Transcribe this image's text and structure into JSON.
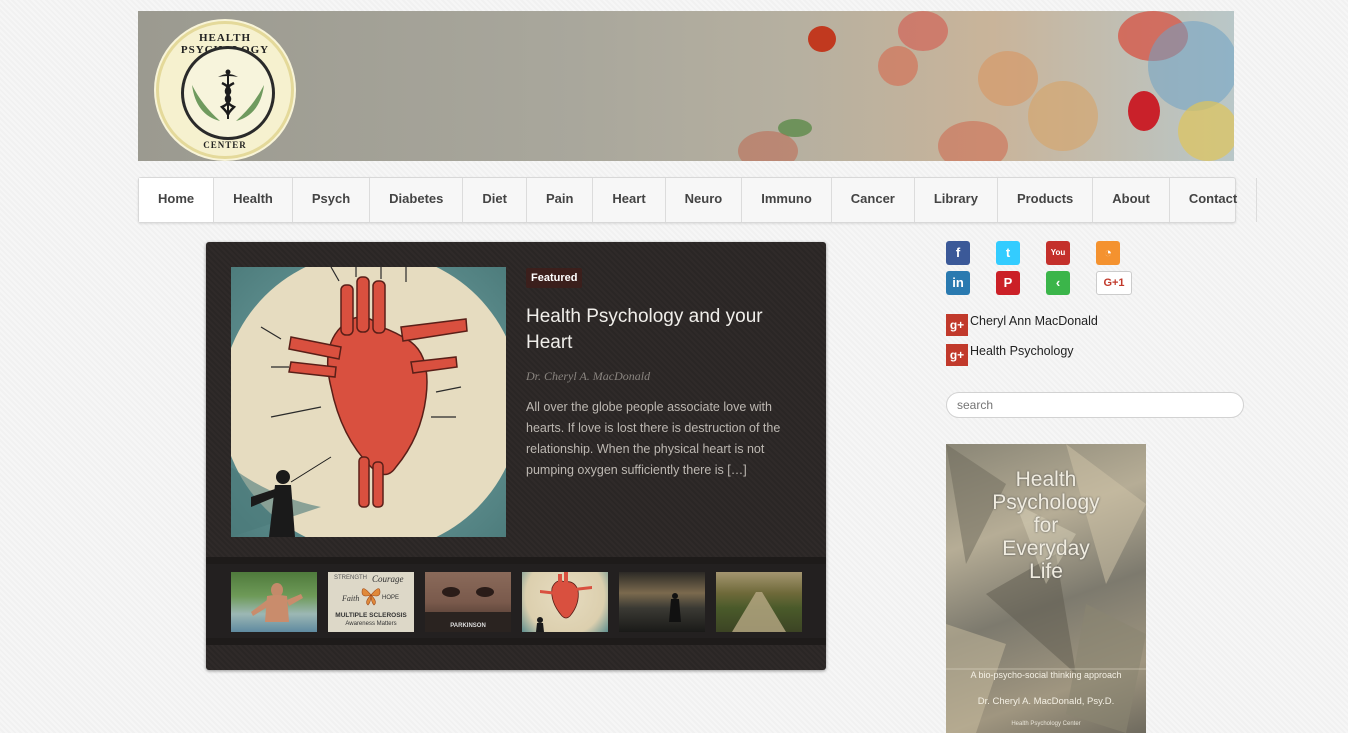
{
  "header": {
    "logo": {
      "top_text": "HEALTH PSYCHOLOGY",
      "bottom_text": "CENTER",
      "icon": "caduceus-icon"
    }
  },
  "nav": {
    "items": [
      {
        "label": "Home",
        "active": true
      },
      {
        "label": "Health"
      },
      {
        "label": "Psych"
      },
      {
        "label": "Diabetes"
      },
      {
        "label": "Diet"
      },
      {
        "label": "Pain"
      },
      {
        "label": "Heart"
      },
      {
        "label": "Neuro"
      },
      {
        "label": "Immuno"
      },
      {
        "label": "Cancer"
      },
      {
        "label": "Library"
      },
      {
        "label": "Products"
      },
      {
        "label": "About"
      },
      {
        "label": "Contact"
      }
    ]
  },
  "featured": {
    "badge": "Featured",
    "title": "Health Psychology and your Heart",
    "author": "Dr. Cheryl A. MacDonald",
    "excerpt": "All over the globe people associate love with hearts. If love is lost there is destruction of the relationship. When the physical heart is not pumping oxygen sufficiently there is […]",
    "image": "heart-anatomy-illustration"
  },
  "thumbnails": [
    {
      "name": "swimmer-thumbnail"
    },
    {
      "name": "multiple-sclerosis-thumbnail",
      "lines": [
        "STRENGTH",
        "Courage",
        "Faith",
        "HOPE",
        "MULTIPLE SCLEROSIS",
        "Awareness Matters"
      ]
    },
    {
      "name": "parkinson-thumbnail",
      "caption": "PARKINSON"
    },
    {
      "name": "heart-thumbnail"
    },
    {
      "name": "sunset-woman-thumbnail"
    },
    {
      "name": "country-road-thumbnail"
    }
  ],
  "social": {
    "icons": [
      {
        "name": "facebook-icon",
        "glyph": "f",
        "color": "#3b5998"
      },
      {
        "name": "twitter-icon",
        "glyph": "t",
        "color": "#33ccff"
      },
      {
        "name": "youtube-icon",
        "glyph": "You",
        "color": "#c4302b"
      },
      {
        "name": "rss-icon",
        "glyph": "◔",
        "color": "#f4922f"
      },
      {
        "name": "linkedin-icon",
        "glyph": "in",
        "color": "#2a7ab0"
      },
      {
        "name": "pinterest-icon",
        "glyph": "P",
        "color": "#cb2027"
      },
      {
        "name": "share-icon",
        "glyph": "‹",
        "color": "#3bb54a"
      },
      {
        "name": "google-plus-icon",
        "glyph": "G+1",
        "color": "#ffffff"
      }
    ]
  },
  "gplus_links": [
    {
      "label": "Cheryl Ann MacDonald"
    },
    {
      "label": "Health Psychology"
    }
  ],
  "search": {
    "placeholder": "search"
  },
  "book": {
    "title_lines": [
      "Health",
      "Psychology",
      "for",
      "Everyday",
      "Life"
    ],
    "subtitle": "A bio-psycho-social thinking approach",
    "author": "Dr. Cheryl A. MacDonald, Psy.D.",
    "publisher": "Health Psychology Center"
  }
}
